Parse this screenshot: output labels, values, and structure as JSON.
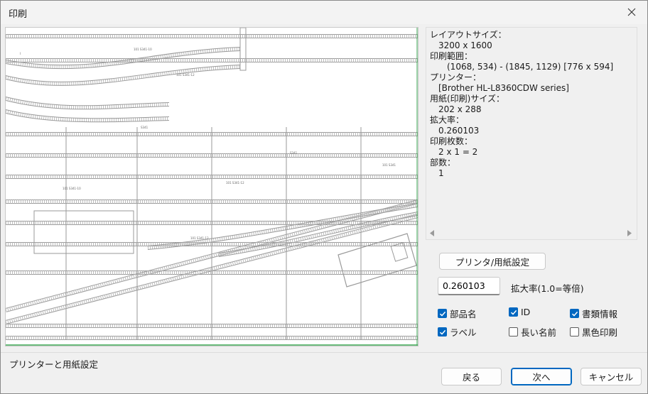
{
  "window": {
    "title": "印刷",
    "close_icon": "close-icon"
  },
  "info": {
    "layout_size_label": "レイアウトサイズ：",
    "layout_size_value": "3200 x 1600",
    "print_range_label": "印刷範囲：",
    "print_range_value": "(1068, 534) - (1845, 1129) [776 x 594]",
    "printer_label": "プリンター：",
    "printer_value": "[Brother HL-L8360CDW series]",
    "paper_size_label": "用紙(印刷)サイズ：",
    "paper_size_value": "202 x 288",
    "zoom_label": "拡大率：",
    "zoom_value": "0.260103",
    "sheets_label": "印刷枚数：",
    "sheets_value": "2 x 1 = 2",
    "copies_label": "部数：",
    "copies_value": "1"
  },
  "buttons": {
    "printer_setup": "プリンタ/用紙設定",
    "back": "戻る",
    "next": "次へ",
    "cancel": "キャンセル"
  },
  "zoom": {
    "value": "0.260103",
    "label": "拡大率(1.0=等倍)"
  },
  "options": [
    {
      "label": "部品名",
      "checked": true
    },
    {
      "label": "ID",
      "checked": true
    },
    {
      "label": "書類情報",
      "checked": true
    },
    {
      "label": "ラベル",
      "checked": true
    },
    {
      "label": "長い名前",
      "checked": false
    },
    {
      "label": "黒色印刷",
      "checked": false
    }
  ],
  "status": "プリンターと用紙設定",
  "colors": {
    "accent": "#0067c0",
    "preview_border_green": "#3aa650"
  }
}
